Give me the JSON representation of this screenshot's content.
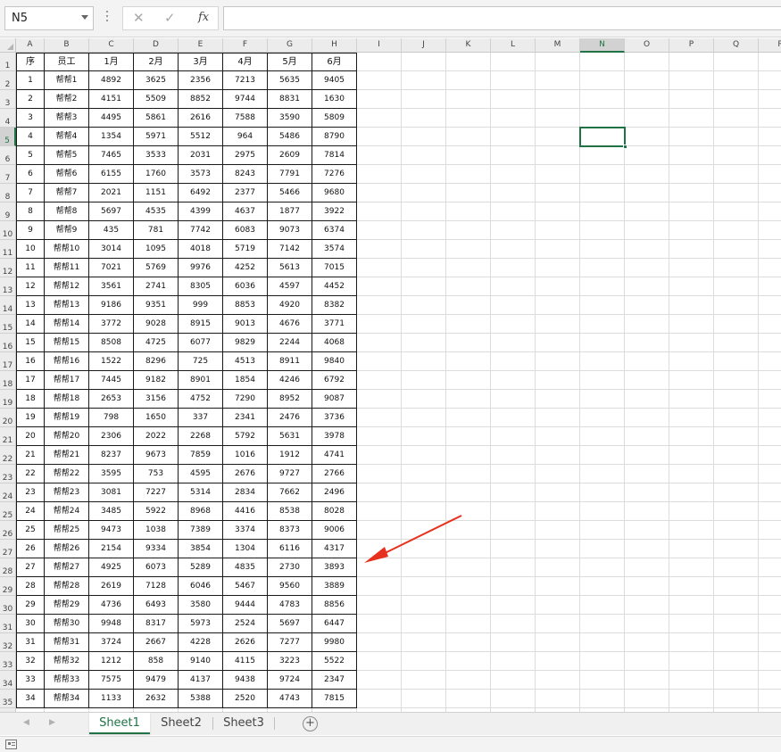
{
  "formula_bar": {
    "name_box": "N5",
    "cancel_glyph": "✕",
    "confirm_glyph": "✓",
    "fx_label": "fx",
    "formula": ""
  },
  "column_letters": [
    "A",
    "B",
    "C",
    "D",
    "E",
    "F",
    "G",
    "H",
    "I",
    "J",
    "K",
    "L",
    "M",
    "N",
    "O",
    "P",
    "Q",
    "R"
  ],
  "selected_column": "N",
  "selected_row": 5,
  "sheet": {
    "header": [
      "序",
      "员工",
      "1月",
      "2月",
      "3月",
      "4月",
      "5月",
      "6月"
    ],
    "rows": [
      [
        "1",
        "帮帮1",
        "4892",
        "3625",
        "2356",
        "7213",
        "5635",
        "9405"
      ],
      [
        "2",
        "帮帮2",
        "4151",
        "5509",
        "8852",
        "9744",
        "8831",
        "1630"
      ],
      [
        "3",
        "帮帮3",
        "4495",
        "5861",
        "2616",
        "7588",
        "3590",
        "5809"
      ],
      [
        "4",
        "帮帮4",
        "1354",
        "5971",
        "5512",
        "964",
        "5486",
        "8790"
      ],
      [
        "5",
        "帮帮5",
        "7465",
        "3533",
        "2031",
        "2975",
        "2609",
        "7814"
      ],
      [
        "6",
        "帮帮6",
        "6155",
        "1760",
        "3573",
        "8243",
        "7791",
        "7276"
      ],
      [
        "7",
        "帮帮7",
        "2021",
        "1151",
        "6492",
        "2377",
        "5466",
        "9680"
      ],
      [
        "8",
        "帮帮8",
        "5697",
        "4535",
        "4399",
        "4637",
        "1877",
        "3922"
      ],
      [
        "9",
        "帮帮9",
        "435",
        "781",
        "7742",
        "6083",
        "9073",
        "6374"
      ],
      [
        "10",
        "帮帮10",
        "3014",
        "1095",
        "4018",
        "5719",
        "7142",
        "3574"
      ],
      [
        "11",
        "帮帮11",
        "7021",
        "5769",
        "9976",
        "4252",
        "5613",
        "7015"
      ],
      [
        "12",
        "帮帮12",
        "3561",
        "2741",
        "8305",
        "6036",
        "4597",
        "4452"
      ],
      [
        "13",
        "帮帮13",
        "9186",
        "9351",
        "999",
        "8853",
        "4920",
        "8382"
      ],
      [
        "14",
        "帮帮14",
        "3772",
        "9028",
        "8915",
        "9013",
        "4676",
        "3771"
      ],
      [
        "15",
        "帮帮15",
        "8508",
        "4725",
        "6077",
        "9829",
        "2244",
        "4068"
      ],
      [
        "16",
        "帮帮16",
        "1522",
        "8296",
        "725",
        "4513",
        "8911",
        "9840"
      ],
      [
        "17",
        "帮帮17",
        "7445",
        "9182",
        "8901",
        "1854",
        "4246",
        "6792"
      ],
      [
        "18",
        "帮帮18",
        "2653",
        "3156",
        "4752",
        "7290",
        "8952",
        "9087"
      ],
      [
        "19",
        "帮帮19",
        "798",
        "1650",
        "337",
        "2341",
        "2476",
        "3736"
      ],
      [
        "20",
        "帮帮20",
        "2306",
        "2022",
        "2268",
        "5792",
        "5631",
        "3978"
      ],
      [
        "21",
        "帮帮21",
        "8237",
        "9673",
        "7859",
        "1016",
        "1912",
        "4741"
      ],
      [
        "22",
        "帮帮22",
        "3595",
        "753",
        "4595",
        "2676",
        "9727",
        "2766"
      ],
      [
        "23",
        "帮帮23",
        "3081",
        "7227",
        "5314",
        "2834",
        "7662",
        "2496"
      ],
      [
        "24",
        "帮帮24",
        "3485",
        "5922",
        "8968",
        "4416",
        "8538",
        "8028"
      ],
      [
        "25",
        "帮帮25",
        "9473",
        "1038",
        "7389",
        "3374",
        "8373",
        "9006"
      ],
      [
        "26",
        "帮帮26",
        "2154",
        "9334",
        "3854",
        "1304",
        "6116",
        "4317"
      ],
      [
        "27",
        "帮帮27",
        "4925",
        "6073",
        "5289",
        "4835",
        "2730",
        "3893"
      ],
      [
        "28",
        "帮帮28",
        "2619",
        "7128",
        "6046",
        "5467",
        "9560",
        "3889"
      ],
      [
        "29",
        "帮帮29",
        "4736",
        "6493",
        "3580",
        "9444",
        "4783",
        "8856"
      ],
      [
        "30",
        "帮帮30",
        "9948",
        "8317",
        "5973",
        "2524",
        "5697",
        "6447"
      ],
      [
        "31",
        "帮帮31",
        "3724",
        "2667",
        "4228",
        "2626",
        "7277",
        "9980"
      ],
      [
        "32",
        "帮帮32",
        "1212",
        "858",
        "9140",
        "4115",
        "3223",
        "5522"
      ],
      [
        "33",
        "帮帮33",
        "7575",
        "9479",
        "4137",
        "9438",
        "9724",
        "2347"
      ],
      [
        "34",
        "帮帮34",
        "1133",
        "2632",
        "5388",
        "2520",
        "4743",
        "7815"
      ]
    ]
  },
  "sheet_tabs": {
    "nav_prev": "◀",
    "nav_next": "▶",
    "tabs": [
      {
        "label": "Sheet1",
        "active": true
      },
      {
        "label": "Sheet2",
        "active": false
      },
      {
        "label": "Sheet3",
        "active": false
      }
    ],
    "add_glyph": "+"
  },
  "colors": {
    "accent": "#217346",
    "annotation": "#e8301e",
    "gridline": "#dcdcdc",
    "header_bg": "#ececec"
  }
}
